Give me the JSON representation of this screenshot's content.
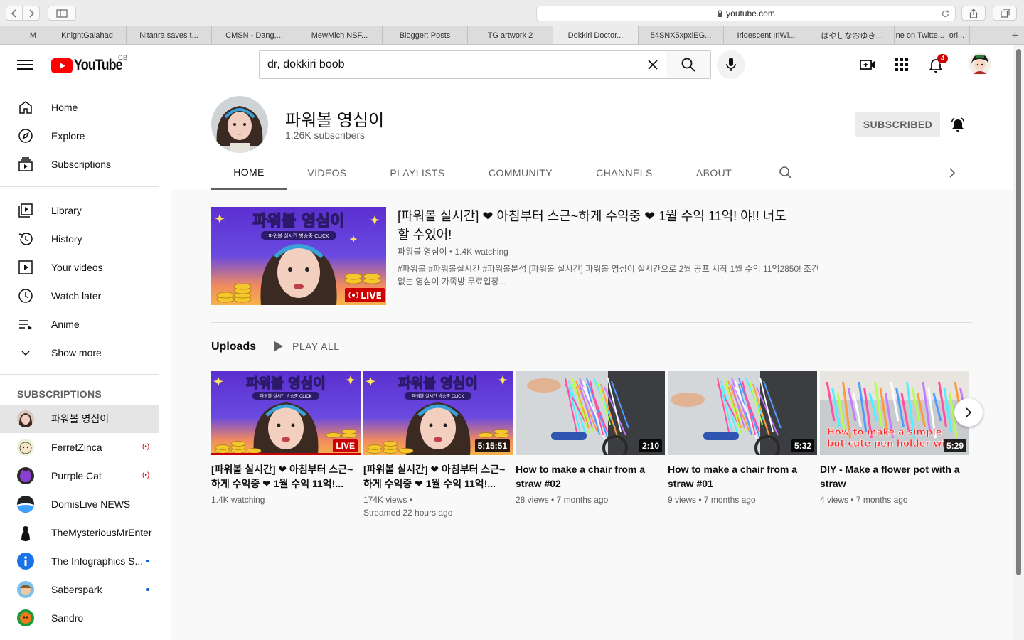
{
  "browser": {
    "url": "youtube.com",
    "tabs": [
      "M",
      "KnightGalahad",
      "Nitanra saves t...",
      "CMSN - Dang,...",
      "MewMich NSF...",
      "Blogger: Posts",
      "TG artwork 2",
      "Dokkiri Doctor...",
      "54SNX5xpxlEG...",
      "Iridescent IriWi...",
      "はやしなおゆき...",
      "ine on Twitte...",
      "ori..."
    ],
    "active_tab": "Dokkiri Doctor...",
    "new_tab_label": "+"
  },
  "header": {
    "logo_text": "YouTube",
    "country_code": "GB",
    "search_query": "dr, dokkiri boob",
    "notification_count": "4"
  },
  "sidebar": {
    "main_items": [
      "Home",
      "Explore",
      "Subscriptions"
    ],
    "library_items": [
      "Library",
      "History",
      "Your videos",
      "Watch later",
      "Anime",
      "Show more"
    ],
    "subscriptions_heading": "SUBSCRIPTIONS",
    "subscriptions": [
      {
        "name": "파워볼 영심이",
        "indicator": "none"
      },
      {
        "name": "FerretZinca",
        "indicator": "live"
      },
      {
        "name": "Purrple Cat",
        "indicator": "live"
      },
      {
        "name": "DomisLive NEWS",
        "indicator": "none"
      },
      {
        "name": "TheMysteriousMrEnter",
        "indicator": "none"
      },
      {
        "name": "The Infographics S...",
        "indicator": "dot"
      },
      {
        "name": "Saberspark",
        "indicator": "dot"
      },
      {
        "name": "Sandro",
        "indicator": "none"
      }
    ]
  },
  "channel": {
    "name": "파워볼 영심이",
    "subscribers": "1.26K subscribers",
    "subscribe_button": "SUBSCRIBED",
    "tabs": [
      "HOME",
      "VIDEOS",
      "PLAYLISTS",
      "COMMUNITY",
      "CHANNELS",
      "ABOUT"
    ],
    "active_tab": "HOME"
  },
  "featured": {
    "thumb_heading": "파워볼 영심이",
    "thumb_subheading": "파워볼 실시간 방송중 CLICK",
    "title": "[파워볼 실시간] ❤ 아침부터 스근~하게 수익중 ❤ 1월 수익 11억! 야!! 너도 할 수있어!",
    "meta": "파워볼 영심이 • 1.4K watching",
    "description": "#파워볼 #파워볼실시간 #파워볼분석 [파워볼 실시간] 파워볼 영심이 실시간으로 2월 공프 시작 1월 수익 11억2850! 조건없는 영심이 가족방 무료입장...",
    "live_label": "LIVE"
  },
  "uploads": {
    "title": "Uploads",
    "play_all": "PLAY ALL",
    "videos": [
      {
        "title": "[파워볼 실시간] ❤ 아침부터 스근~하게 수익중 ❤ 1월 수익 11억!...",
        "badge": "LIVE",
        "meta1": "1.4K watching",
        "meta2": "",
        "thumb_heading": "파워볼 영심이",
        "thumb_subheading": "파워볼 실시간 방송중 CLICK",
        "thumb_caption": ""
      },
      {
        "title": "[파워볼 실시간] ❤ 아침부터 스근~하게 수익중 ❤ 1월 수익 11억!...",
        "badge": "5:15:51",
        "meta1": "174K views •",
        "meta2": "Streamed 22 hours ago",
        "thumb_heading": "파워볼 영심이",
        "thumb_subheading": "파워볼 실시간 방송중 CLICK",
        "thumb_caption": ""
      },
      {
        "title": "How to make a chair from a straw #02",
        "badge": "2:10",
        "meta1": "28 views • 7 months ago",
        "meta2": "",
        "thumb_heading": "",
        "thumb_subheading": "",
        "thumb_caption": ""
      },
      {
        "title": "How to make a chair from a straw #01",
        "badge": "5:32",
        "meta1": "9 views • 7 months ago",
        "meta2": "",
        "thumb_heading": "",
        "thumb_subheading": "",
        "thumb_caption": ""
      },
      {
        "title": "DIY - Make a flower pot with a straw",
        "badge": "5:29",
        "meta1": "4 views • 7 months ago",
        "meta2": "",
        "thumb_heading": "",
        "thumb_subheading": "",
        "thumb_caption": "How to make a simple but cute pen holder with"
      }
    ]
  },
  "colors": {
    "brand_red": "#ff0000",
    "live_red": "#cc0000",
    "link_blue": "#065fd4",
    "secondary_text": "#606060"
  }
}
